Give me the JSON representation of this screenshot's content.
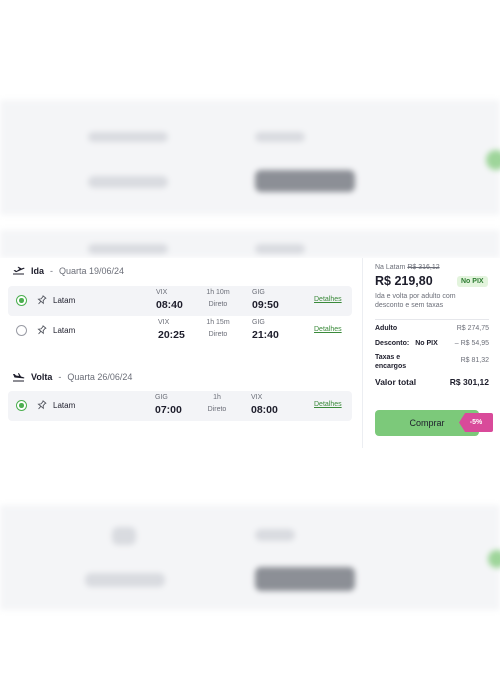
{
  "outbound": {
    "label": "Ida",
    "separator": "-",
    "date": "Quarta 19/06/24",
    "flights": [
      {
        "airline": "Latam",
        "from_code": "VIX",
        "depart": "08:40",
        "duration": "1h 10m",
        "kind": "Direto",
        "to_code": "GIG",
        "arrive": "09:50",
        "details": "Detalhes",
        "selected": true
      },
      {
        "airline": "Latam",
        "from_code": "VIX",
        "depart": "20:25",
        "duration": "1h 15m",
        "kind": "Direto",
        "to_code": "GIG",
        "arrive": "21:40",
        "details": "Detalhes",
        "selected": false
      }
    ]
  },
  "return": {
    "label": "Volta",
    "separator": "-",
    "date": "Quarta 26/06/24",
    "flights": [
      {
        "airline": "Latam",
        "from_code": "GIG",
        "depart": "07:00",
        "duration": "1h",
        "kind": "Direto",
        "to_code": "VIX",
        "arrive": "08:00",
        "details": "Detalhes",
        "selected": true
      }
    ]
  },
  "price": {
    "na_latam_label": "Na Latam",
    "na_latam_old": "R$ 316,12",
    "amount": "R$ 219,80",
    "pix_badge": "No PIX",
    "note": "Ida e volta por adulto com desconto e sem taxas",
    "adult_label": "Adulto",
    "adult_value": "R$ 274,75",
    "discount_label": "Desconto:",
    "discount_method": "No PIX",
    "discount_value": "– R$ 54,95",
    "taxes_label": "Taxas e encargos",
    "taxes_value": "R$ 81,32",
    "total_label": "Valor total",
    "total_value": "R$ 301,12",
    "buy_label": "Comprar",
    "discount_badge": "-5%"
  },
  "colors": {
    "accent_green": "#7cc97a",
    "radio_green": "#4caf50",
    "badge_pink": "#d94a9a"
  }
}
